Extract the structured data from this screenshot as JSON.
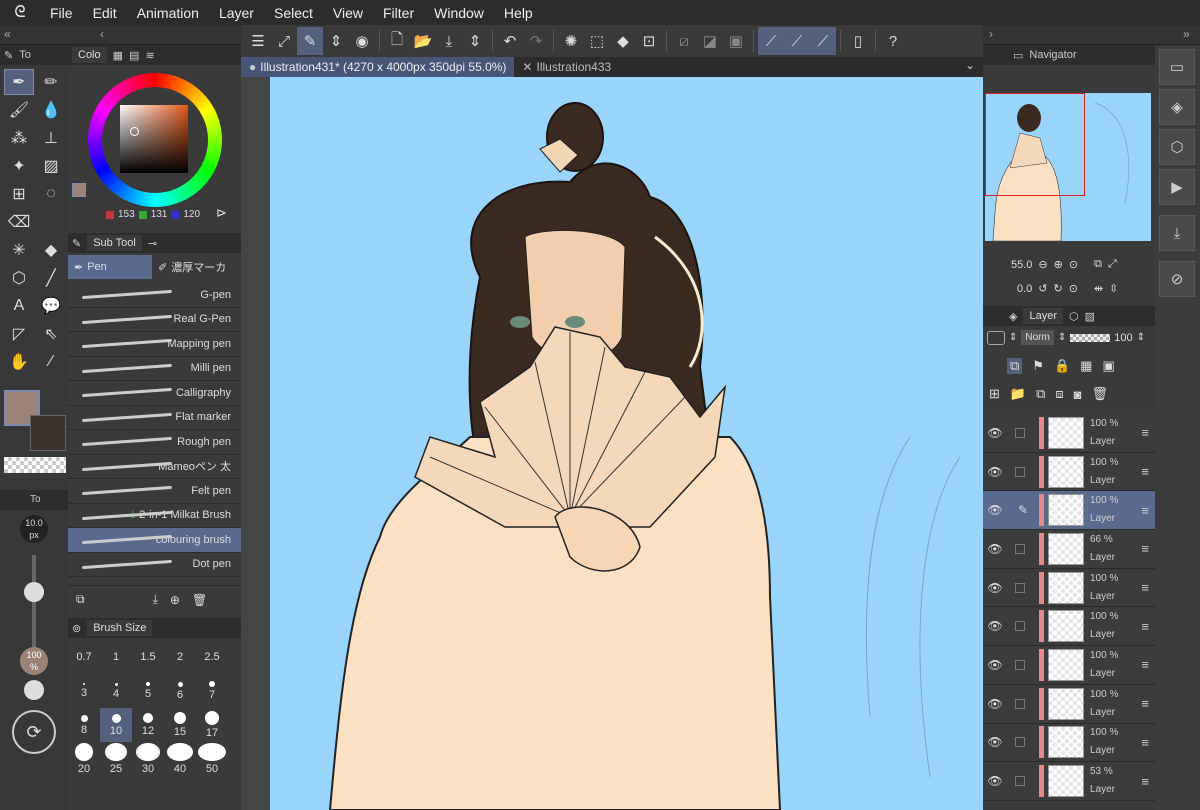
{
  "menu": {
    "items": [
      "File",
      "Edit",
      "Animation",
      "Layer",
      "Select",
      "View",
      "Filter",
      "Window",
      "Help"
    ]
  },
  "document_tabs": [
    {
      "label": "Illustration431* (4270 x 4000px 350dpi 55.0%)"
    },
    {
      "label": "Illustration433"
    }
  ],
  "tool_panel": {
    "title": "To"
  },
  "tool_property": {
    "title": "To",
    "brush_size": "10.0\npx",
    "opacity": "100\n%"
  },
  "color_panel": {
    "title": "Colo",
    "r": "153",
    "g": "131",
    "b": "120",
    "current_color": "#9c8378",
    "sub_color": "#3b312d",
    "accent": "#5a6a8d"
  },
  "subtool_panel": {
    "title": "Sub Tool",
    "groups": [
      "Pen",
      "濃厚マーカ"
    ],
    "brushes": [
      "G-pen",
      "Real G-Pen",
      "Mapping pen",
      "Milli pen",
      "Calligraphy",
      "Flat marker",
      "Rough pen",
      "Mameoペン 太",
      "Felt pen",
      "2-in-1 Milkat Brush",
      "colouring brush",
      "Dot pen"
    ],
    "selected": "colouring brush"
  },
  "brush_size_panel": {
    "title": "Brush Size",
    "sizes": [
      "0.7",
      "1",
      "1.5",
      "2",
      "2.5",
      "3",
      "4",
      "5",
      "6",
      "7",
      "8",
      "10",
      "12",
      "15",
      "17",
      "20",
      "25",
      "30",
      "40",
      "50"
    ],
    "selected": "10"
  },
  "navigator": {
    "title": "Navigator",
    "zoom": "55.0",
    "rotation": "0.0"
  },
  "layer_panel": {
    "title": "Layer",
    "blend_mode": "Norm",
    "opacity": "100",
    "layers": [
      {
        "opacity": "100 %",
        "name": "Layer"
      },
      {
        "opacity": "100 %",
        "name": "Layer"
      },
      {
        "opacity": "100 %",
        "name": "Layer"
      },
      {
        "opacity": "66 %",
        "name": "Layer"
      },
      {
        "opacity": "100 %",
        "name": "Layer"
      },
      {
        "opacity": "100 %",
        "name": "Layer"
      },
      {
        "opacity": "100 %",
        "name": "Layer"
      },
      {
        "opacity": "100 %",
        "name": "Layer"
      },
      {
        "opacity": "100 %",
        "name": "Layer"
      },
      {
        "opacity": "53 %",
        "name": "Layer"
      }
    ]
  }
}
